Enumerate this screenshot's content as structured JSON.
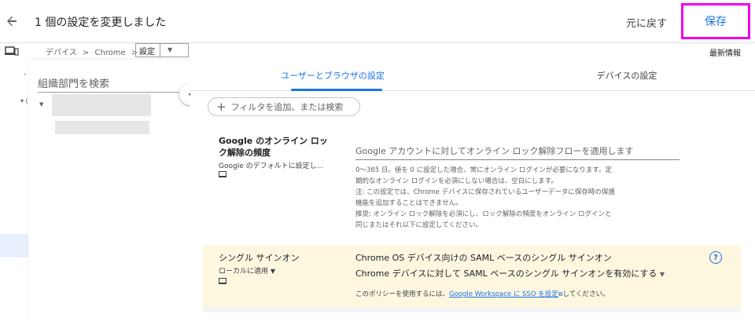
{
  "header": {
    "back_icon": "arrow-back-icon",
    "title": "1 個の設定を変更しました",
    "undo_label": "元に戻す",
    "save_label": "保存",
    "save_highlight_color": "#ee00ee"
  },
  "breadcrumb": {
    "device_icon": "devices-icon",
    "items": [
      "デバイス",
      "Chrome"
    ],
    "separator": ">",
    "selected": "設定",
    "latest_info": "最新情報"
  },
  "org_panel": {
    "search_placeholder": "組織部門を検索",
    "collapse_icon": "chevron-left-icon"
  },
  "tabs": [
    {
      "label": "ユーザーとブラウザの設定",
      "active": true
    },
    {
      "label": "デバイスの設定",
      "active": false
    }
  ],
  "filter": {
    "label": "フィルタを追加、または検索"
  },
  "settings": [
    {
      "title": "Google のオンライン ロック解除の頻度",
      "source": "Google のデフォルトに設定し...",
      "input_placeholder": "Google アカウントに対してオンライン ロック解除フローを適用します",
      "description": [
        "0～365 日。値を 0 に設定した場合、常にオンライン ログインが必要になります。定",
        "期的なオンライン ログインを必須にしない場合は、空白にします。",
        "注: この設定では、Chrome デバイスに保存されているユーザーデータに保存時の保護",
        "機能を追加することはできません。",
        "推奨: オンライン ロック解除を必須にし、ロック解除の頻度をオンライン ログインと",
        "同じまたはそれ以下に設定してください。"
      ]
    },
    {
      "title": "シングル サインオン",
      "source": "ローカルに適用",
      "line1": "Chrome OS デバイス向けの SAML ベースのシングル サインオン",
      "line2": "Chrome デバイスに対して SAML ベースのシングル サインオンを有効にする",
      "note_prefix": "このポリシーを使用するには、",
      "note_link": "Google Workspace に SSO を設定",
      "note_suffix": "してください。",
      "highlight_color": "#fef7e0"
    }
  ],
  "colors": {
    "accent": "#1a73e8"
  }
}
